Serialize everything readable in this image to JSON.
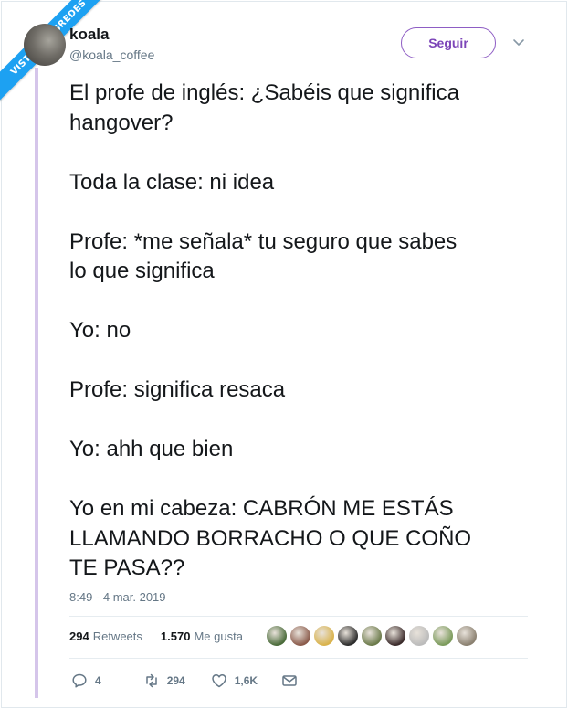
{
  "watermark": "VISTOENLASREDES",
  "user": {
    "name": "koala",
    "handle": "@koala_coffee"
  },
  "follow_label": "Seguir",
  "tweet": {
    "text": "El profe de inglés: ¿Sabéis que significa\nhangover?\n\nToda la clase: ni idea\n\nProfe: *me señala* tu seguro que sabes\nlo que significa\n\nYo: no\n\nProfe: significa resaca\n\nYo: ahh que bien\n\nYo en mi cabeza: CABRÓN ME ESTÁS\nLLAMANDO BORRACHO O QUE COÑO\nTE PASA??",
    "timestamp": "8:49 - 4 mar. 2019"
  },
  "stats": {
    "retweets_count": "294",
    "retweets_label": "Retweets",
    "likes_count": "1.570",
    "likes_label": "Me gusta"
  },
  "likers": [
    "#4a6b3a",
    "#8a5a4a",
    "#d9b24a",
    "#2b2b2b",
    "#6b7a4a",
    "#3a2a2a",
    "#bbbbbb",
    "#7a9a5a",
    "#8a8070"
  ],
  "actions": {
    "replies": "4",
    "retweets": "294",
    "likes": "1,6K"
  },
  "colors": {
    "accent": "#7c45b8",
    "ribbon": "#1da1f2",
    "thread_line": "#d5c5ea"
  }
}
